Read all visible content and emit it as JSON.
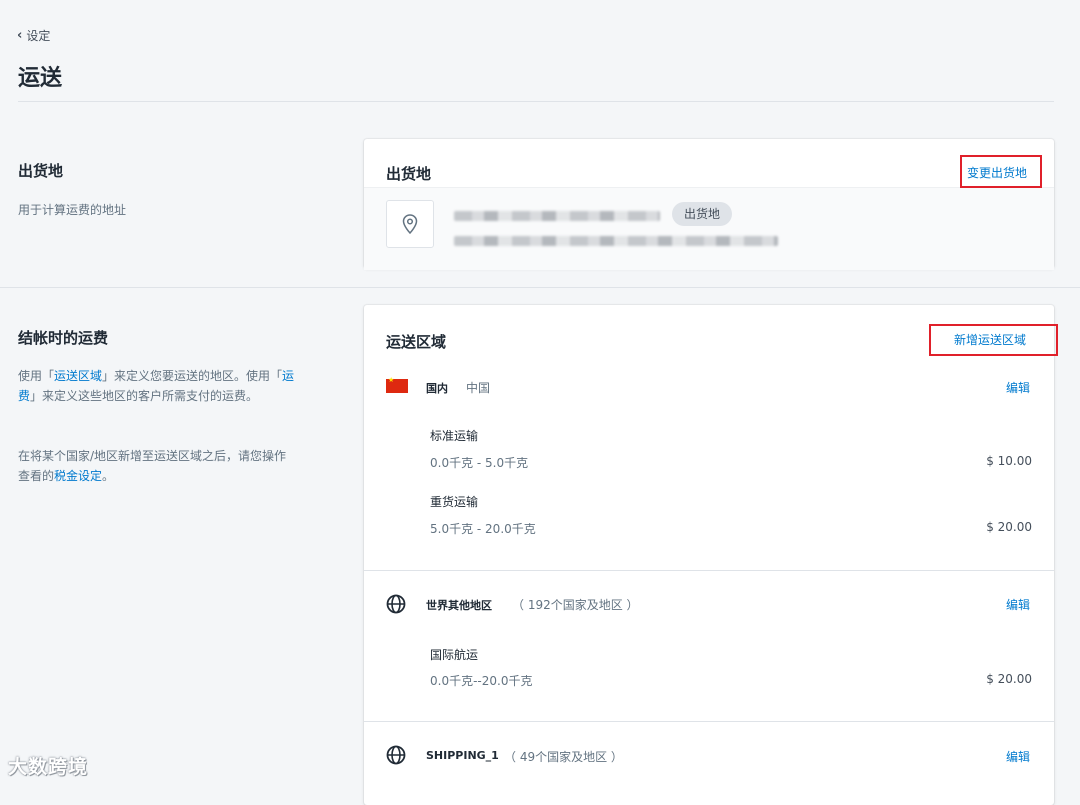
{
  "header": {
    "back_label": "设定",
    "title": "运送"
  },
  "origin_section": {
    "title": "出货地",
    "description": "用于计算运费的地址",
    "card": {
      "title": "出货地",
      "change_link": "变更出货地",
      "badge": "出货地"
    }
  },
  "rates_section": {
    "title": "结帐时的运费",
    "desc_p1_a": "使用「",
    "desc_link_zones": "运送区域",
    "desc_p1_b": "」来定义您要运送的地区。使用「",
    "desc_link_rates": "运费",
    "desc_p1_c": "」来定义这些地区的客户所需支付的运费。",
    "desc_p2_a": "在将某个国家/地区新增至运送区域之后，请您操作查看的",
    "desc_link_tax": "税金设定",
    "desc_p2_b": "。",
    "card": {
      "title": "运送区域",
      "add_link": "新增运送区域",
      "edit_label": "编辑",
      "zones": [
        {
          "name": "国内",
          "sub": "中国",
          "icon": "china-flag-icon",
          "rates": [
            {
              "name": "标准运输",
              "range": "0.0千克 - 5.0千克",
              "price": "$ 10.00"
            },
            {
              "name": "重货运输",
              "range": "5.0千克 - 20.0千克",
              "price": "$ 20.00"
            }
          ]
        },
        {
          "name": "世界其他地区",
          "sub": "（ 192个国家及地区 ）",
          "icon": "globe-icon",
          "rates": [
            {
              "name": "国际航运",
              "range": "0.0千克--20.0千克",
              "price": "$ 20.00"
            }
          ]
        },
        {
          "name": "SHIPPING_1",
          "sub": "（ 49个国家及地区 ）",
          "icon": "globe-icon",
          "rates": []
        }
      ]
    }
  },
  "watermark": "大数跨境",
  "colors": {
    "link": "#007ace",
    "highlight_box": "#e0202a",
    "background": "#f4f6f8"
  }
}
